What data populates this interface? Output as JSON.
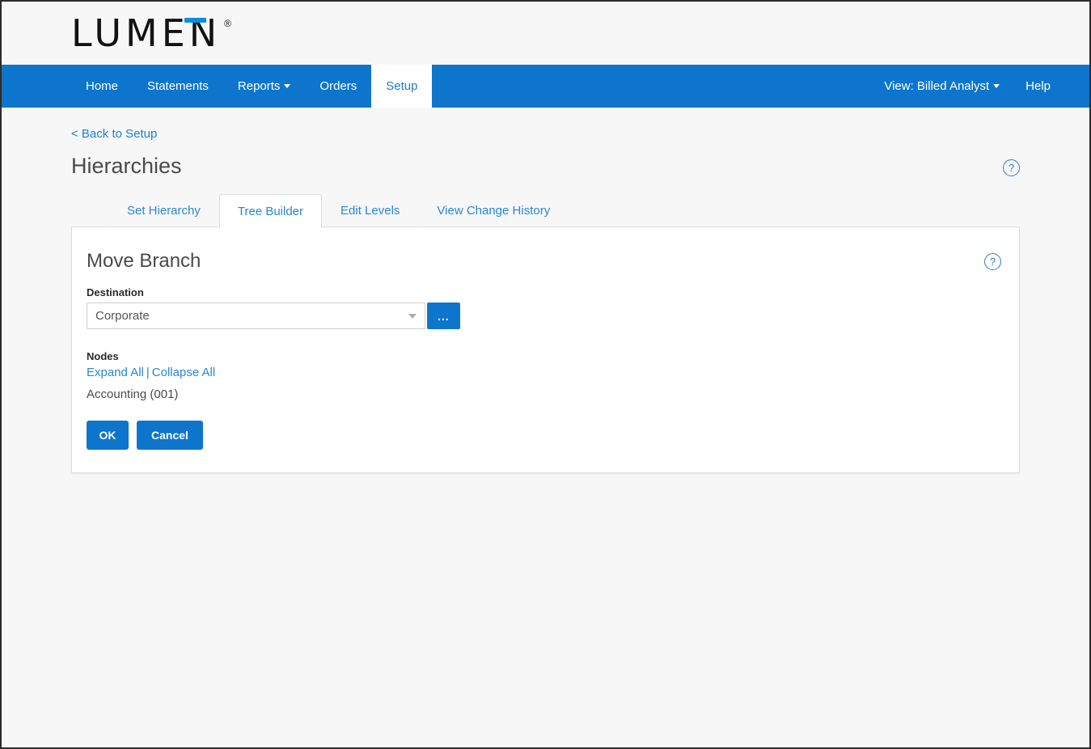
{
  "brand": {
    "logo_text": "LUMEN",
    "registered_mark": "®"
  },
  "nav": {
    "items": [
      {
        "label": "Home",
        "active": false,
        "has_caret": false
      },
      {
        "label": "Statements",
        "active": false,
        "has_caret": false
      },
      {
        "label": "Reports",
        "active": false,
        "has_caret": true
      },
      {
        "label": "Orders",
        "active": false,
        "has_caret": false
      },
      {
        "label": "Setup",
        "active": true,
        "has_caret": false
      }
    ],
    "view_label": "View: Billed Analyst",
    "help_label": "Help"
  },
  "page": {
    "back_link": "< Back to Setup",
    "title": "Hierarchies",
    "help_icon_glyph": "?"
  },
  "tabs": [
    {
      "label": "Set Hierarchy",
      "active": false
    },
    {
      "label": "Tree Builder",
      "active": true
    },
    {
      "label": "Edit Levels",
      "active": false
    },
    {
      "label": "View Change History",
      "active": false
    }
  ],
  "panel": {
    "title": "Move Branch",
    "help_icon_glyph": "?",
    "destination": {
      "label": "Destination",
      "value": "Corporate",
      "placeholder": "Corporate",
      "browse_button_label": "...",
      "caret_icon": "chevron-down-icon"
    },
    "nodes": {
      "label": "Nodes",
      "expand_all": "Expand All",
      "separator": "|",
      "collapse_all": "Collapse All",
      "items": [
        {
          "label": "Accounting (001)"
        }
      ]
    },
    "actions": {
      "ok_label": "OK",
      "cancel_label": "Cancel"
    }
  },
  "colors": {
    "brand_blue": "#0d76cc",
    "logo_accent": "#0b8de0",
    "link_blue": "#2a86d6",
    "page_bg": "#f7f7f7",
    "panel_border": "#dcdcdc"
  }
}
